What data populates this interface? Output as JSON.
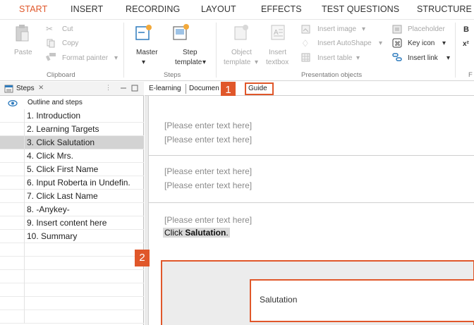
{
  "ribbon_tabs": [
    "START",
    "INSERT",
    "RECORDING",
    "LAYOUT",
    "EFFECTS",
    "TEST QUESTIONS",
    "STRUCTURE"
  ],
  "active_tab": "START",
  "clipboard": {
    "paste": "Paste",
    "cut": "Cut",
    "copy": "Copy",
    "format_painter": "Format painter",
    "group": "Clipboard"
  },
  "steps_group": {
    "master": "Master",
    "step": "Step",
    "template": "template",
    "group": "Steps"
  },
  "presentation_objects": {
    "object": "Object",
    "object_template": "template",
    "insert": "Insert",
    "textbox": "textbox",
    "insert_image": "Insert image",
    "insert_autoshape": "Insert AutoShape",
    "insert_table": "Insert table",
    "placeholder": "Placeholder",
    "key_icon": "Key icon",
    "insert_link": "Insert link",
    "group": "Presentation objects"
  },
  "ribbon_right": {
    "b": "B",
    "x2": "x²",
    "f": "F"
  },
  "steps_panel": {
    "title": "Steps",
    "close": "⨯",
    "outline_label": "Outline and steps",
    "selected_index": 2,
    "steps": [
      "1. Introduction",
      "2. Learning Targets",
      "3. Click Salutation",
      "4. Click Mrs.",
      "5. Click First Name",
      "6. Input Roberta in Undefin.",
      "7. Click Last Name",
      "8.  -Anykey-",
      "9. Insert content here",
      "10. Summary"
    ]
  },
  "doc_tabs": [
    "E-learning",
    "Documen",
    "Guide"
  ],
  "badges": {
    "one": "1",
    "two": "2"
  },
  "blocks": {
    "placeholder": "[Please enter text here]",
    "instruction_prefix": "Click ",
    "instruction_bold": "Salutation",
    "instruction_suffix": "."
  },
  "callout_label": "Salutation",
  "colors": {
    "accent": "#e0572a",
    "selection": "#d3d3d3"
  }
}
